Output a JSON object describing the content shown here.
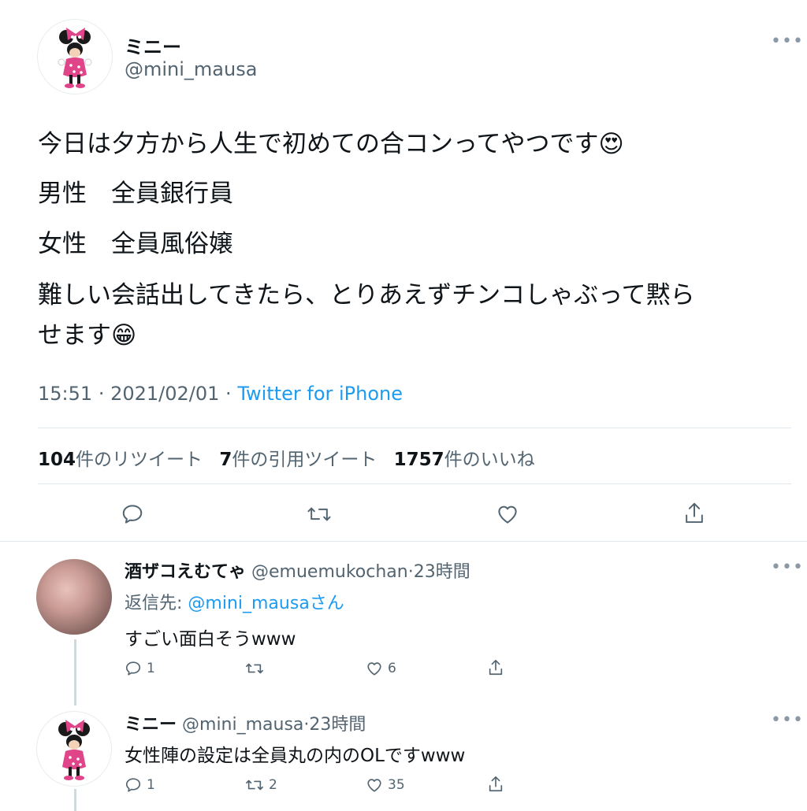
{
  "main_tweet": {
    "author_name": "ミニー",
    "author_handle": "@mini_mausa",
    "more_icon": "more-icon",
    "lines": [
      "今日は夕方から人生で初めての合コンってやつです😍",
      "男性　全員銀行員",
      "女性　全員風俗嬢",
      "難しい会話出してきたら、とりあえずチンコしゃぶって黙ら",
      "せます😁"
    ],
    "time": "15:51",
    "date": "2021/02/01",
    "source": "Twitter for iPhone",
    "stats": {
      "retweets_count": "104",
      "retweets_label": "件のリツイート",
      "quotes_count": "7",
      "quotes_label": "件の引用ツイート",
      "likes_count": "1757",
      "likes_label": "件のいいね"
    }
  },
  "replies": [
    {
      "author_name": "酒ザコえむてゃ",
      "author_handle": "@emuemukochan",
      "time": "23時間",
      "reply_to_prefix": "返信先: ",
      "reply_to_mention": "@mini_mausaさん",
      "text": "すごい面白そうwww",
      "reply_count": "1",
      "retweet_count": "",
      "like_count": "6"
    },
    {
      "author_name": "ミニー",
      "author_handle": "@mini_mausa",
      "time": "23時間",
      "text": "女性陣の設定は全員丸の内のOLですwww",
      "reply_count": "1",
      "retweet_count": "2",
      "like_count": "35"
    }
  ],
  "colors": {
    "accent": "#1d9bf0",
    "text": "#0f1419",
    "secondary": "#536471"
  }
}
